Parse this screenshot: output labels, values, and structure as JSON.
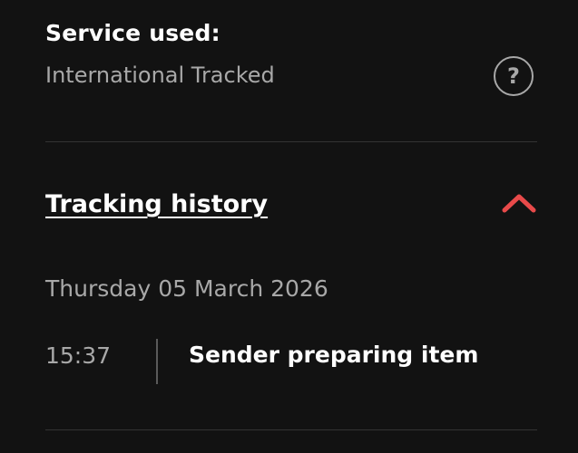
{
  "service": {
    "label": "Service used:",
    "value": "International Tracked",
    "help_icon": "?"
  },
  "tracking_history": {
    "title": "Tracking history",
    "toggle_icon": "chevron-up-icon",
    "accent_color": "#e84a4a",
    "date": "Thursday 05 March 2026",
    "events": [
      {
        "time": "15:37",
        "description": "Sender preparing item"
      }
    ]
  }
}
